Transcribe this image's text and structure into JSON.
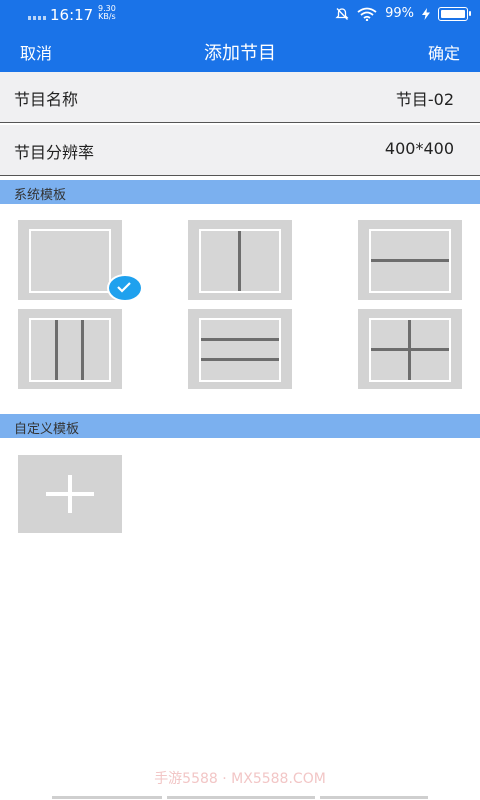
{
  "status_bar": {
    "time": "16:17",
    "net_speed_value": "9.30",
    "net_speed_unit": "KB/s",
    "battery": "99%"
  },
  "nav": {
    "cancel": "取消",
    "title": "添加节目",
    "confirm": "确定"
  },
  "fields": [
    {
      "label": "节目名称",
      "value": "节目-02"
    },
    {
      "label": "节目分辨率",
      "value": "400*400"
    }
  ],
  "sections": {
    "system_templates": "系统模板",
    "custom_templates": "自定义模板"
  },
  "watermark": "手游5588 · MX5588.COM",
  "colors": {
    "primary": "#1a73e8",
    "section_header": "#7bb0ef",
    "check": "#1fa1ee"
  },
  "icons": {
    "selected": "check-circle-icon",
    "add": "plus-icon"
  }
}
